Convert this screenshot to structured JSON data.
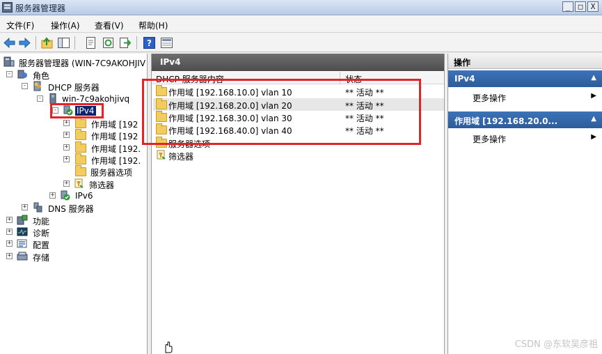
{
  "window": {
    "title": "服务器管理器",
    "controls": {
      "minimize": "_",
      "maximize": "□",
      "close": "X"
    }
  },
  "menu": [
    "文件(F)",
    "操作(A)",
    "查看(V)",
    "帮助(H)"
  ],
  "toolbar_icons": [
    "back-arrow-icon",
    "forward-arrow-icon",
    "up-folder-icon",
    "show-hide-tree-icon",
    "properties-icon",
    "refresh-icon",
    "export-list-icon",
    "help-icon",
    "view-icon"
  ],
  "tree": {
    "root": "服务器管理器 (WIN-7C9AKOHJIV",
    "roles": "角色",
    "dhcp": "DHCP 服务器",
    "host": "win-7c9akohjivq",
    "ipv4": "IPv4",
    "scopes": [
      "作用域 [192",
      "作用域 [192",
      "作用域 [192.",
      "作用域 [192."
    ],
    "server_options": "服务器选项",
    "filters": "筛选器",
    "ipv6": "IPv6",
    "dns": "DNS 服务器",
    "features": "功能",
    "diagnostics": "诊断",
    "configuration": "配置",
    "storage": "存储",
    "expander_plus": "+",
    "expander_minus": "-"
  },
  "content": {
    "header": "IPv4",
    "columns": [
      "DHCP 服务器内容",
      "状态"
    ],
    "rows": [
      {
        "name": "作用域 [192.168.10.0] vlan 10",
        "status": "** 活动 **"
      },
      {
        "name": "作用域 [192.168.20.0] vlan 20",
        "status": "** 活动 **"
      },
      {
        "name": "作用域 [192.168.30.0] vlan 30",
        "status": "** 活动 **"
      },
      {
        "name": "作用域 [192.168.40.0] vlan 40",
        "status": "** 活动 **"
      }
    ],
    "extra_rows": [
      "服务器选项",
      "筛选器"
    ]
  },
  "actions": {
    "title": "操作",
    "sections": [
      {
        "title": "IPv4",
        "item": "更多操作"
      },
      {
        "title": "作用域 [192.168.20.0...",
        "item": "更多操作"
      }
    ],
    "collapse_glyph": "▲",
    "submenu_glyph": "▶"
  },
  "watermark": "CSDN @东软吴彦祖",
  "colors": {
    "highlight": "#e32328",
    "selection": "#0a246a",
    "action_header": "#3c74b8"
  }
}
